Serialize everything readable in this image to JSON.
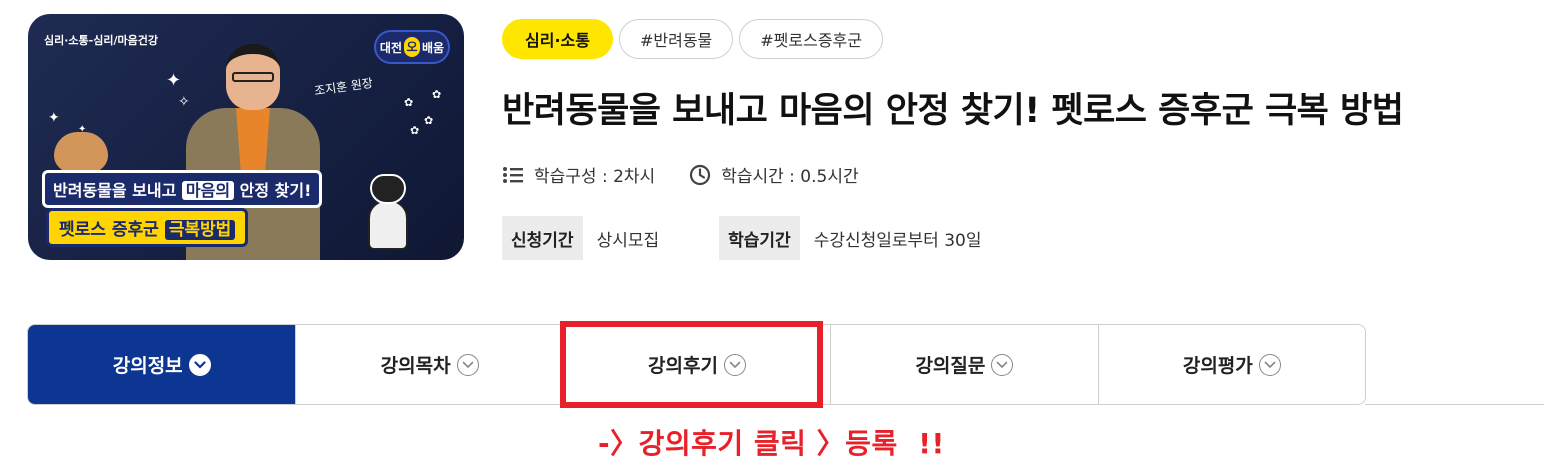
{
  "thumbnail": {
    "category_line": "심리·소통-심리/마음건강",
    "logo_left": "대전",
    "logo_mid": "오",
    "logo_right": "배움",
    "instructor_script": "조지훈 원장",
    "banner_line1_a": "반려동물",
    "banner_line1_b": "을 보내고 ",
    "banner_line1_c": "마음의",
    "banner_line1_d": " 안정 찾기!",
    "banner_line2_a": "펫로스 증후군",
    "banner_line2_b": "극복방법"
  },
  "tags": [
    {
      "label": "심리·소통"
    },
    {
      "label": "#반려동물"
    },
    {
      "label": "#펫로스증후군"
    }
  ],
  "course": {
    "title": "반려동물을 보내고 마음의 안정 찾기! 펫로스 증후군 극복 방법",
    "composition": "학습구성 : 2차시",
    "duration": "학습시간 : 0.5시간",
    "apply_label": "신청기간",
    "apply_value": "상시모집",
    "study_label": "학습기간",
    "study_value": "수강신청일로부터 30일"
  },
  "tabs": [
    {
      "label": "강의정보",
      "active": true
    },
    {
      "label": "강의목차",
      "active": false
    },
    {
      "label": "강의후기",
      "active": false
    },
    {
      "label": "강의질문",
      "active": false
    },
    {
      "label": "강의평가",
      "active": false
    }
  ],
  "annotation": {
    "note": "-〉강의후기 클릭 〉등록  !!"
  },
  "colors": {
    "accent_navy": "#0d3692",
    "tag_yellow": "#ffe600",
    "annotation_red": "#e8202a"
  },
  "icons": {
    "composition": "list-icon",
    "duration": "clock-icon",
    "tab_toggle": "chevron-down-circle-icon"
  }
}
